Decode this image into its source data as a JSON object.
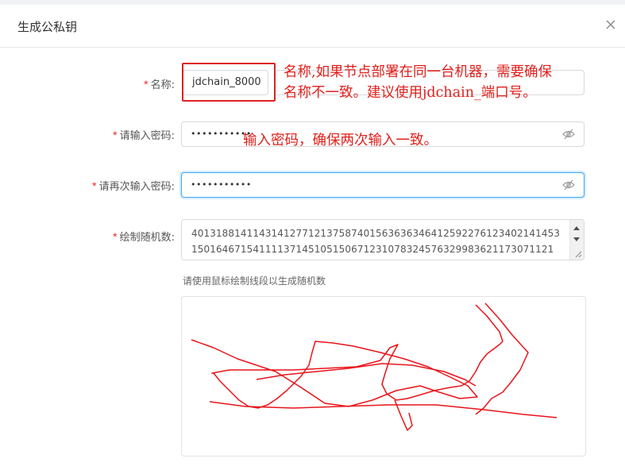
{
  "dialog": {
    "title": "生成公私钥",
    "close_icon": "close-icon"
  },
  "form": {
    "name": {
      "required_mark": "*",
      "label": "名称:",
      "value": "jdchain_8000"
    },
    "password": {
      "required_mark": "*",
      "label": "请输入密码:",
      "value": "•••••••••••",
      "toggle_icon": "eye-invisible-icon"
    },
    "password_confirm": {
      "required_mark": "*",
      "label": "请再次输入密码:",
      "value": "•••••••••••",
      "toggle_icon": "eye-invisible-icon"
    },
    "random": {
      "required_mark": "*",
      "label": "绘制随机数:",
      "value": "40131881411431412771213758740156363634641259227612340214145315016467154111137145105150671231078324576329983621173071121"
    },
    "draw_hint": "请使用鼠标绘制线段以生成随机数"
  },
  "annotations": {
    "note_name_line1": "名称,如果节点部署在同一台机器，需要确保",
    "note_name_line2": "名称不一致。建议使用jdchain_端口号。",
    "note_password": "输入密码，确保两次输入一致。",
    "color": "#e0201c"
  },
  "colors": {
    "required": "#f5222d",
    "focus_border": "#40a9ff",
    "stroke": "#e8141a"
  }
}
